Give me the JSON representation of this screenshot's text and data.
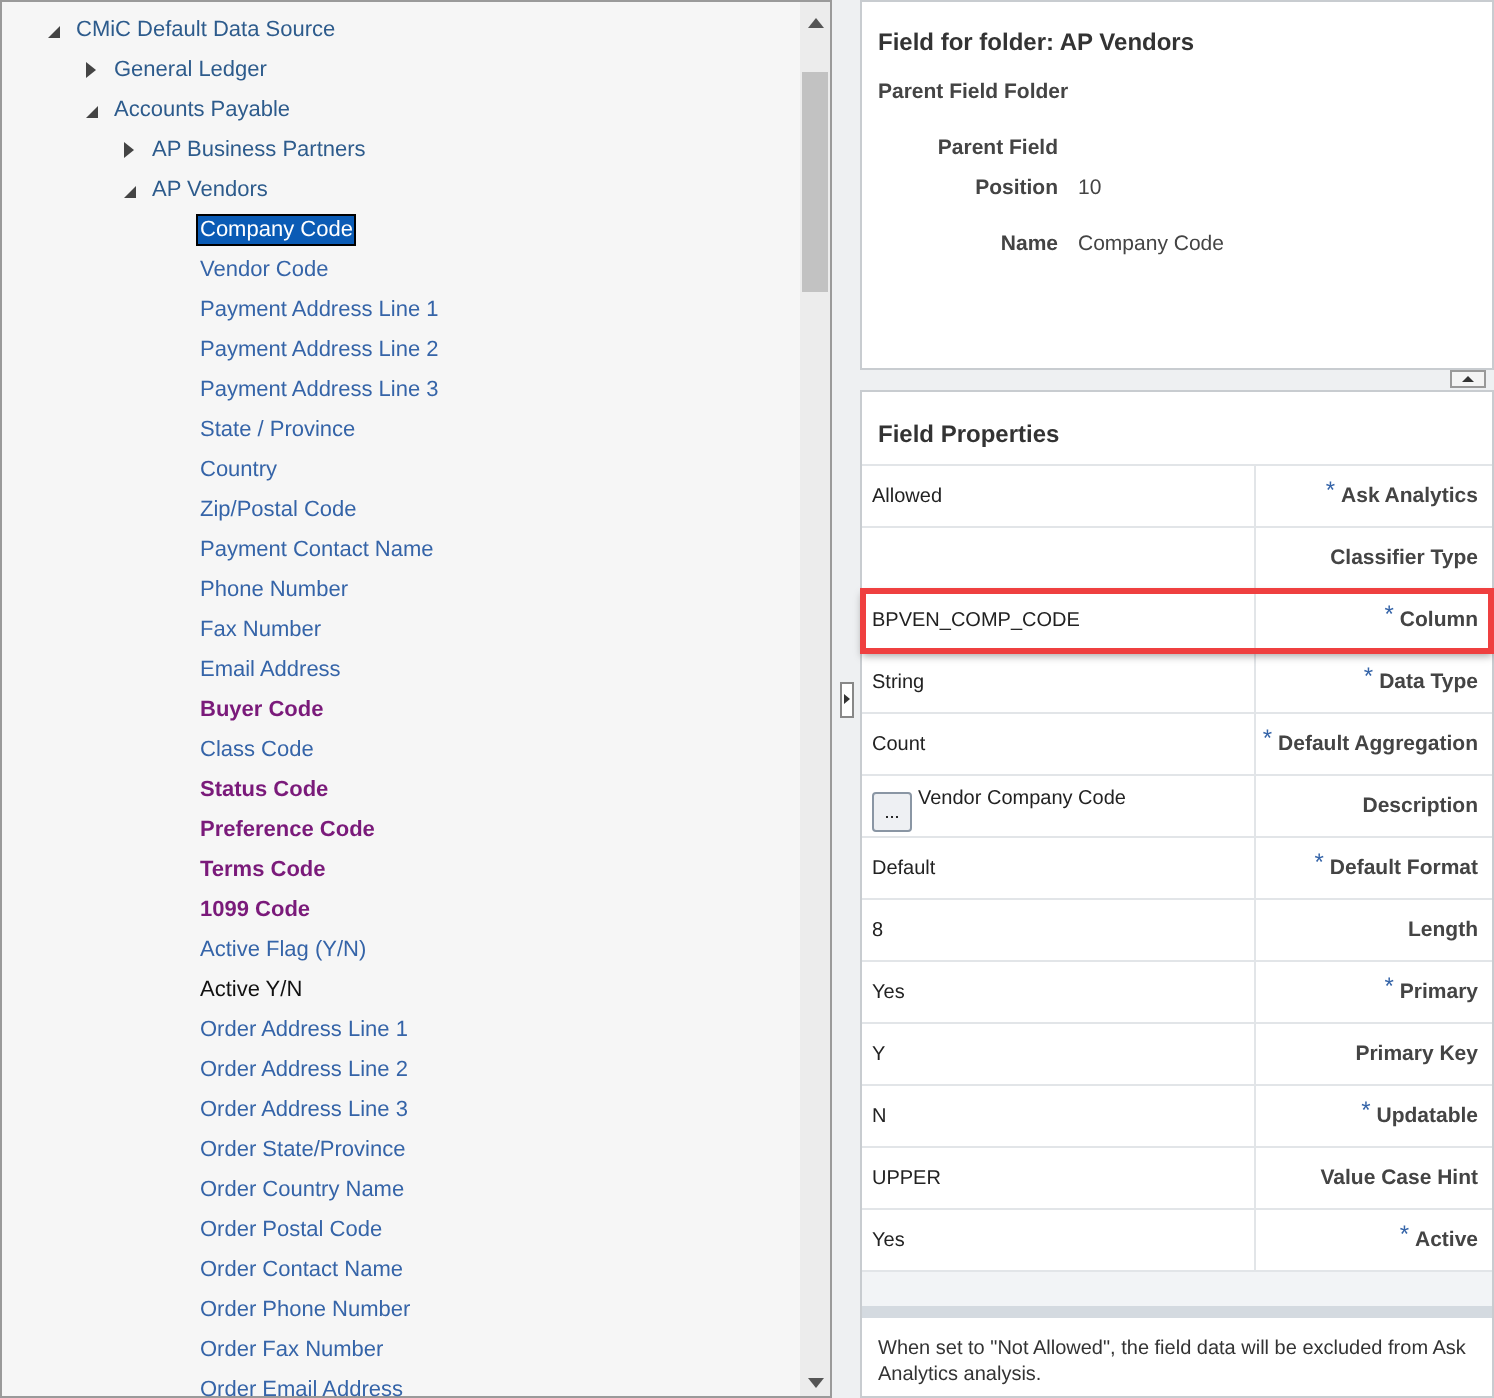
{
  "tree": [
    {
      "kind": "folder",
      "label": "CMiC Default Data Source",
      "expanded": true,
      "children": [
        {
          "kind": "folder",
          "label": "General Ledger",
          "expanded": false
        },
        {
          "kind": "folder",
          "label": "Accounts Payable",
          "expanded": true,
          "children": [
            {
              "kind": "folder",
              "label": "AP Business Partners",
              "expanded": false
            },
            {
              "kind": "folder",
              "label": "AP Vendors",
              "expanded": true,
              "children": [
                {
                  "kind": "field",
                  "label": "Company Code",
                  "selected": true
                },
                {
                  "kind": "field",
                  "label": "Vendor Code",
                  "selected": false
                },
                {
                  "kind": "field",
                  "label": "Payment Address Line 1",
                  "selected": false
                },
                {
                  "kind": "field",
                  "label": "Payment Address Line 2",
                  "selected": false
                },
                {
                  "kind": "field",
                  "label": "Payment Address Line 3",
                  "selected": false
                },
                {
                  "kind": "field",
                  "label": "State / Province",
                  "selected": false
                },
                {
                  "kind": "field",
                  "label": "Country",
                  "selected": false
                },
                {
                  "kind": "field",
                  "label": "Zip/Postal Code",
                  "selected": false
                },
                {
                  "kind": "field",
                  "label": "Payment Contact Name",
                  "selected": false
                },
                {
                  "kind": "field",
                  "label": "Phone Number",
                  "selected": false
                },
                {
                  "kind": "field",
                  "label": "Fax Number",
                  "selected": false
                },
                {
                  "kind": "field",
                  "label": "Email Address",
                  "selected": false
                },
                {
                  "kind": "key-field",
                  "label": "Buyer Code",
                  "selected": false
                },
                {
                  "kind": "field",
                  "label": "Class Code",
                  "selected": false
                },
                {
                  "kind": "key-field",
                  "label": "Status Code",
                  "selected": false
                },
                {
                  "kind": "key-field",
                  "label": "Preference Code",
                  "selected": false
                },
                {
                  "kind": "key-field",
                  "label": "Terms Code",
                  "selected": false
                },
                {
                  "kind": "key-field",
                  "label": "1099 Code",
                  "selected": false
                },
                {
                  "kind": "field",
                  "label": "Active Flag (Y/N)",
                  "selected": false
                },
                {
                  "kind": "dark-field",
                  "label": "Active Y/N",
                  "selected": false
                },
                {
                  "kind": "field",
                  "label": "Order Address Line 1",
                  "selected": false
                },
                {
                  "kind": "field",
                  "label": "Order Address Line 2",
                  "selected": false
                },
                {
                  "kind": "field",
                  "label": "Order Address Line 3",
                  "selected": false
                },
                {
                  "kind": "field",
                  "label": "Order State/Province",
                  "selected": false
                },
                {
                  "kind": "field",
                  "label": "Order Country Name",
                  "selected": false
                },
                {
                  "kind": "field",
                  "label": "Order Postal Code",
                  "selected": false
                },
                {
                  "kind": "field",
                  "label": "Order Contact Name",
                  "selected": false
                },
                {
                  "kind": "field",
                  "label": "Order Phone Number",
                  "selected": false
                },
                {
                  "kind": "field",
                  "label": "Order Fax Number",
                  "selected": false
                },
                {
                  "kind": "field",
                  "label": "Order Email Address",
                  "selected": false
                }
              ]
            }
          ]
        }
      ]
    }
  ],
  "detail": {
    "title": "Field for folder: AP Vendors",
    "folder_label": "Parent Field Folder",
    "fields": [
      {
        "label": "Parent Field"
      },
      {
        "label": "Position",
        "value": "10"
      },
      {
        "label": "Name",
        "value": "Company Code"
      }
    ]
  },
  "properties": {
    "title": "Field Properties",
    "rows": [
      {
        "value": "Allowed",
        "label": "Ask Analytics",
        "required": true,
        "highlighted": false
      },
      {
        "label": "Classifier Type",
        "required": false,
        "highlighted": false
      },
      {
        "value": "BPVEN_COMP_CODE",
        "label": "Column",
        "required": true,
        "highlighted": true
      },
      {
        "value": "String",
        "label": "Data Type",
        "required": true,
        "highlighted": false
      },
      {
        "value": "Count",
        "label": "Default Aggregation",
        "required": true,
        "highlighted": false
      },
      {
        "value": "Vendor Company Code",
        "button": "...",
        "label": "Description",
        "required": false,
        "highlighted": false
      },
      {
        "value": "Default",
        "label": "Default Format",
        "required": true,
        "highlighted": false
      },
      {
        "value": "8",
        "label": "Length",
        "required": false,
        "highlighted": false
      },
      {
        "value": "Yes",
        "label": "Primary",
        "required": true,
        "highlighted": false
      },
      {
        "value": "Y",
        "label": "Primary Key",
        "required": false,
        "highlighted": false
      },
      {
        "value": "N",
        "label": "Updatable",
        "required": true,
        "highlighted": false
      },
      {
        "value": "UPPER",
        "label": "Value Case Hint",
        "required": false,
        "highlighted": false
      },
      {
        "value": "Yes",
        "label": "Active",
        "required": true,
        "highlighted": false
      }
    ],
    "required_mark": "*",
    "hint": "When set to \"Not Allowed\", the field data will be excluded from Ask Analytics analysis."
  }
}
